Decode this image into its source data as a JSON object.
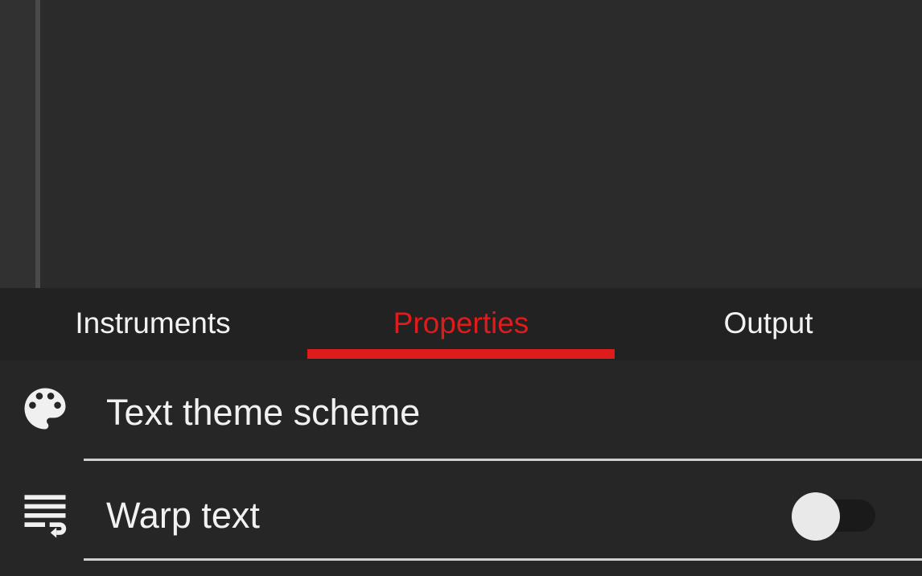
{
  "tabs": [
    {
      "label": "Instruments",
      "active": false
    },
    {
      "label": "Properties",
      "active": true
    },
    {
      "label": "Output",
      "active": false
    }
  ],
  "colors": {
    "accent": "#e01b1b",
    "background": "#242424",
    "editor_background": "#2b2b2b",
    "text": "#f1f1f1"
  },
  "properties": {
    "items": [
      {
        "label": "Text theme scheme",
        "icon": "palette-icon"
      },
      {
        "label": "Warp text",
        "icon": "wrap-text-icon",
        "toggle": "off"
      }
    ]
  }
}
